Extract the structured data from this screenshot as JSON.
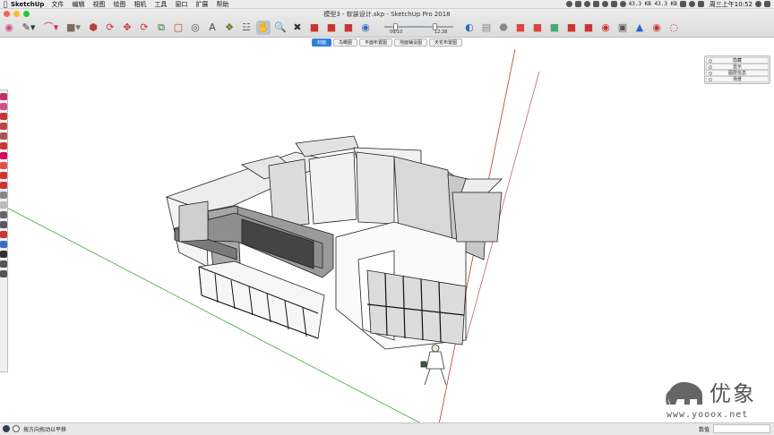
{
  "menubar": {
    "app_name": "SketchUp",
    "items": [
      "文件",
      "编辑",
      "视图",
      "绘图",
      "相机",
      "工具",
      "窗口",
      "扩展",
      "帮助"
    ],
    "net_speed": "43.3 KB 43.3 KB",
    "clock": "周三上午10:52"
  },
  "window": {
    "title": "模型3 - 软装设计.skp - SketchUp Pro 2018"
  },
  "toolbar": {
    "tools": [
      "eraser",
      "pencil",
      "arc",
      "rectangle",
      "push-pull",
      "move",
      "rotate",
      "scale",
      "follow-me",
      "offset",
      "tape-measure",
      "paint-bucket",
      "orbit",
      "pan",
      "zoom",
      "zoom-extents",
      "prev-view",
      "section-plane",
      "component",
      "group",
      "paint"
    ],
    "time_start": "09/10",
    "time_end": "12:38"
  },
  "scene_tabs": [
    {
      "label": "封面",
      "active": true
    },
    {
      "label": "鸟瞰图",
      "active": false
    },
    {
      "label": "平面布置图",
      "active": false
    },
    {
      "label": "地面铺设图",
      "active": false
    },
    {
      "label": "天花布置图",
      "active": false
    }
  ],
  "layers_panel": {
    "items": [
      "隐藏",
      "显示",
      "图层信息",
      "场景"
    ]
  },
  "watermark": {
    "name": "优象",
    "url": "www.yooox.net"
  },
  "status": {
    "hint": "按方向拖动以平移",
    "measure_label": "数值",
    "measure_value": ""
  },
  "colors": {
    "accent": "#2f7fe0",
    "axis_red": "#b33a3a",
    "axis_green": "#3aa83a"
  }
}
